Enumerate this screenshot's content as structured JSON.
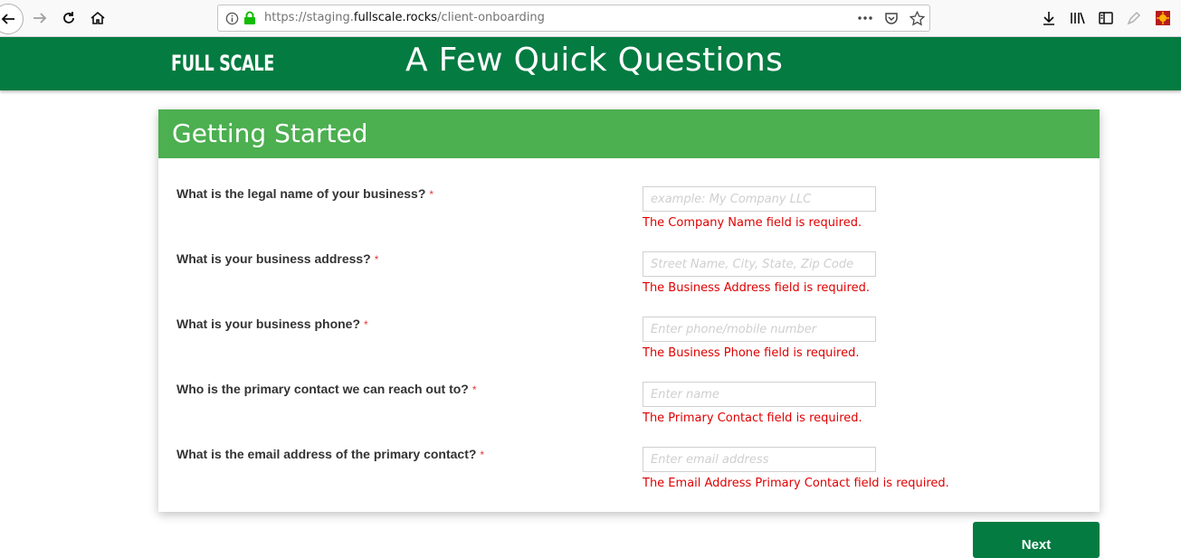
{
  "browser": {
    "url_prefix": "https://staging.",
    "url_host": "fullscale.rocks",
    "url_path": "/client-onboarding",
    "icons": [
      "back-icon",
      "forward-icon",
      "reload-icon",
      "home-icon",
      "info-icon",
      "lock-icon",
      "more-icon",
      "pocket-icon",
      "bookmark-star-icon",
      "download-icon",
      "library-icon",
      "sidebar-icon",
      "pen-icon",
      "extension-icon"
    ]
  },
  "header": {
    "logo": "FULL SCALE",
    "title": "A Few Quick Questions",
    "background": "#037b41"
  },
  "card": {
    "title": "Getting Started",
    "header_color": "#4caf50",
    "required_marker": "*",
    "questions": [
      {
        "label": "What is the legal name of your business?",
        "placeholder": "example: My Company LLC",
        "value": "",
        "error": "The Company Name field is required."
      },
      {
        "label": "What is your business address?",
        "placeholder": "Street Name, City, State, Zip Code",
        "value": "",
        "error": "The Business Address field is required."
      },
      {
        "label": "What is your business phone?",
        "placeholder": "Enter phone/mobile number",
        "value": "",
        "error": "The Business Phone field is required."
      },
      {
        "label": "Who is the primary contact we can reach out to?",
        "placeholder": "Enter name",
        "value": "",
        "error": "The Primary Contact field is required."
      },
      {
        "label": "What is the email address of the primary contact?",
        "placeholder": "Enter email address",
        "value": "",
        "error": "The Email Address Primary Contact field is required."
      }
    ]
  },
  "actions": {
    "next_label": "Next"
  },
  "colors": {
    "error": "#e00000",
    "required": "#e53935"
  }
}
